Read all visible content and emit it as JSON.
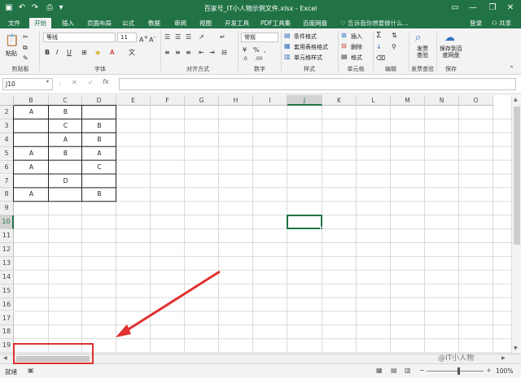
{
  "title": "百家号_IT小人物示例文件.xlsx  -  Excel",
  "tabs": [
    "文件",
    "开始",
    "插入",
    "页面布局",
    "公式",
    "数据",
    "审阅",
    "视图",
    "开发工具",
    "PDF工具集",
    "百度网盘"
  ],
  "tell_me": "告诉我你想要做什么...",
  "login": "登录",
  "share": "共享",
  "ribbon": {
    "paste": "粘贴",
    "clipboard": "剪贴板",
    "font_name": "等线",
    "font_size": "11",
    "font_group": "字体",
    "align_group": "对齐方式",
    "number_format": "常规",
    "number_group": "数字",
    "cond_format": "条件格式",
    "table_format": "套用表格格式",
    "cell_style": "单元格样式",
    "styles_group": "样式",
    "insert": "插入",
    "delete": "删除",
    "format": "格式",
    "cells_group": "单元格",
    "edit_group": "编辑",
    "invoice_check": "发票查验",
    "invoice_group": "发票查验",
    "save_baidu": "保存到百度网盘",
    "save_group": "保存",
    "bold": "B",
    "italic": "I",
    "underline": "U"
  },
  "name_box": "J10",
  "formula": "",
  "columns": [
    "B",
    "C",
    "D",
    "E",
    "F",
    "G",
    "H",
    "I",
    "J",
    "K",
    "L",
    "M",
    "N",
    "O"
  ],
  "rows": [
    "2",
    "3",
    "4",
    "5",
    "6",
    "7",
    "8",
    "9",
    "10",
    "11",
    "12",
    "13",
    "14",
    "15",
    "16",
    "17",
    "18",
    "19"
  ],
  "cells": [
    {
      "row": "2",
      "col": "B",
      "text": "A"
    },
    {
      "row": "2",
      "col": "C",
      "text": "B"
    },
    {
      "row": "3",
      "col": "C",
      "text": "C"
    },
    {
      "row": "3",
      "col": "D",
      "text": "B"
    },
    {
      "row": "4",
      "col": "C",
      "text": "A"
    },
    {
      "row": "4",
      "col": "D",
      "text": "B"
    },
    {
      "row": "5",
      "col": "B",
      "text": "A"
    },
    {
      "row": "5",
      "col": "C",
      "text": "B"
    },
    {
      "row": "5",
      "col": "D",
      "text": "A"
    },
    {
      "row": "6",
      "col": "B",
      "text": "A"
    },
    {
      "row": "6",
      "col": "D",
      "text": "C"
    },
    {
      "row": "7",
      "col": "C",
      "text": "D"
    },
    {
      "row": "8",
      "col": "B",
      "text": "A"
    },
    {
      "row": "8",
      "col": "D",
      "text": "B"
    }
  ],
  "selected_cell": "J10",
  "status": "就绪",
  "zoom": "100%",
  "watermark": "@IT小人物",
  "colors": {
    "excel_green": "#217346",
    "annotation_red": "#e03030"
  }
}
